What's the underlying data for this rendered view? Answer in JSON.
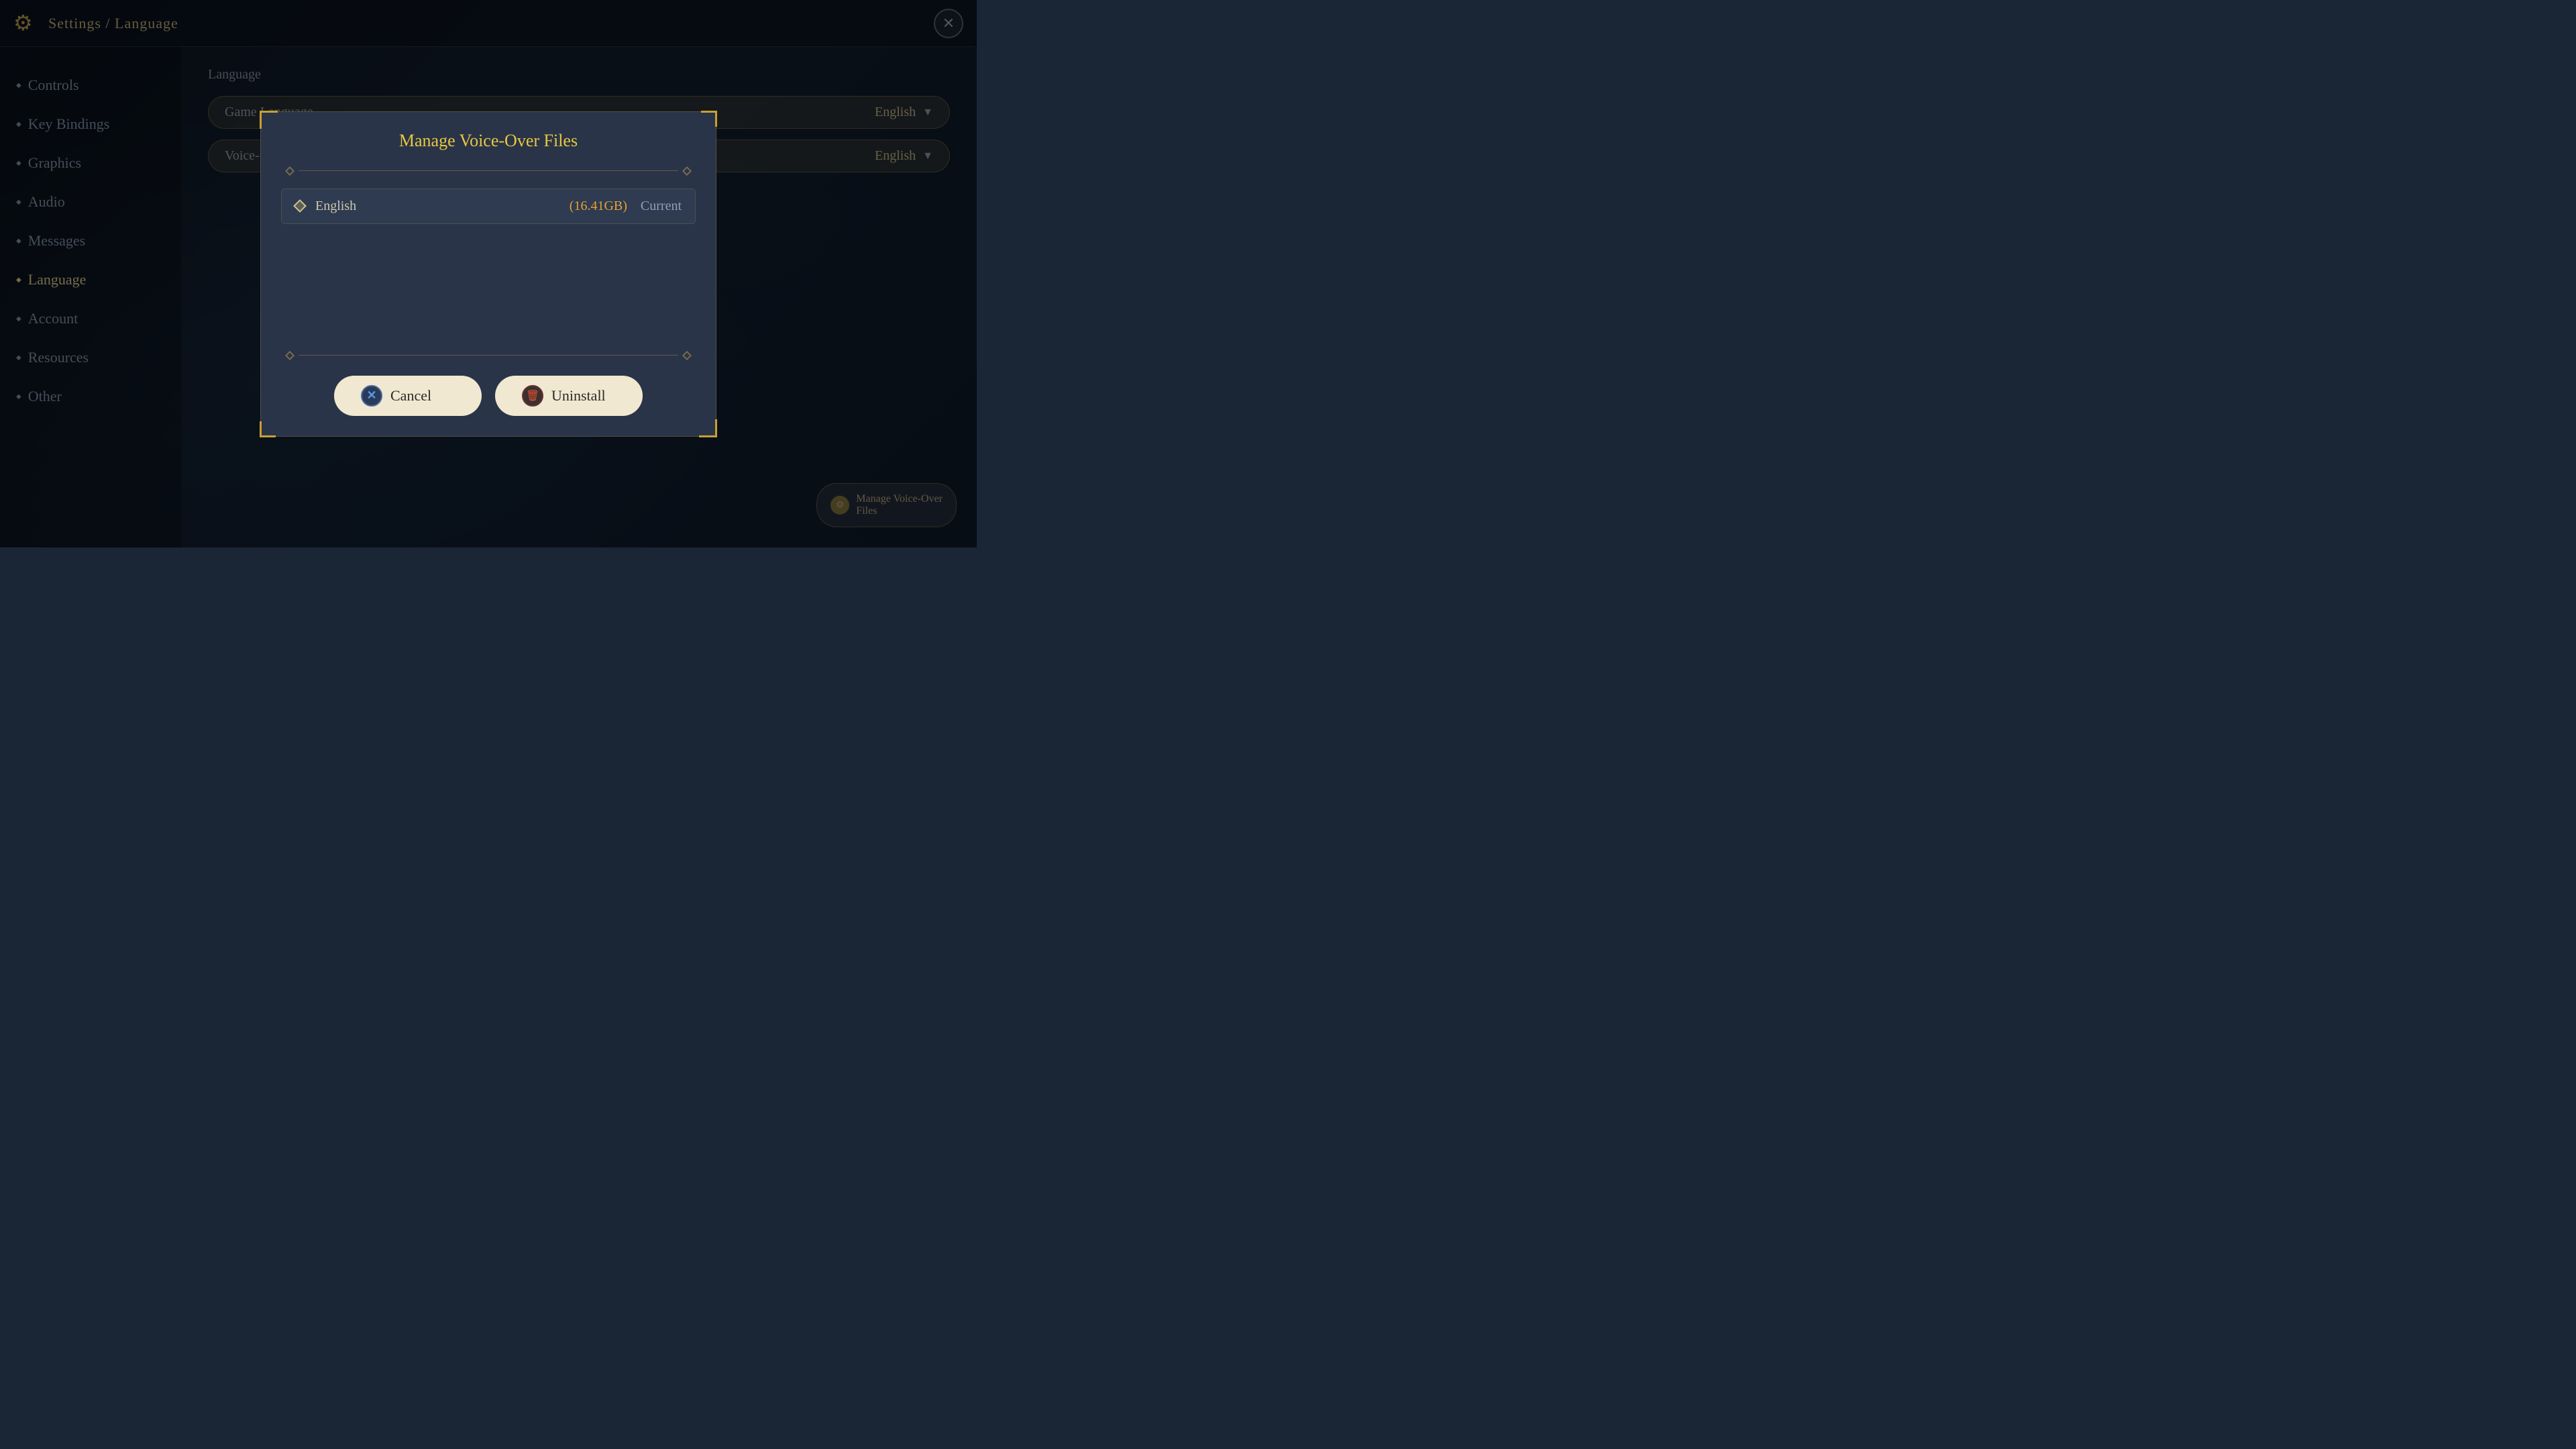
{
  "header": {
    "title": "Settings / Language",
    "close_label": "×"
  },
  "sidebar": {
    "items": [
      {
        "id": "controls",
        "label": "Controls",
        "active": false
      },
      {
        "id": "key-bindings",
        "label": "Key Bindings",
        "active": false
      },
      {
        "id": "graphics",
        "label": "Graphics",
        "active": false
      },
      {
        "id": "audio",
        "label": "Audio",
        "active": false
      },
      {
        "id": "messages",
        "label": "Messages",
        "active": false
      },
      {
        "id": "language",
        "label": "Language",
        "active": true
      },
      {
        "id": "account",
        "label": "Account",
        "active": false
      },
      {
        "id": "resources",
        "label": "Resources",
        "active": false
      },
      {
        "id": "other",
        "label": "Other",
        "active": false
      }
    ]
  },
  "main": {
    "section_title": "Language",
    "dropdowns": [
      {
        "label": "Game Language",
        "value": "English"
      },
      {
        "label": "Voice-Over Language",
        "value": "English"
      }
    ]
  },
  "manage_vo_button": {
    "label": "Manage Voice-Over\nFiles"
  },
  "modal": {
    "title": "Manage Voice-Over Files",
    "divider_diamond": "◆",
    "voice_items": [
      {
        "name": "English",
        "size": "(16.41GB)",
        "status": "Current"
      }
    ],
    "cancel_button": "Cancel",
    "uninstall_button": "Uninstall",
    "cancel_icon": "✕",
    "uninstall_icon": "🗑"
  }
}
